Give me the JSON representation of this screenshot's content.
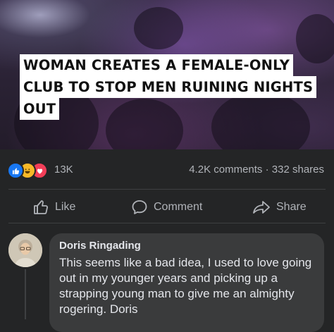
{
  "post": {
    "headline_lines": [
      "WOMAN CREATES A FEMALE-ONLY",
      "CLUB TO STOP MEN RUINING NIGHTS",
      "OUT"
    ]
  },
  "reactions": {
    "icons": [
      "like-icon",
      "haha-icon",
      "love-icon"
    ],
    "count": "13K",
    "comments": "4.2K comments",
    "separator": "·",
    "shares": "332 shares"
  },
  "actions": {
    "like": "Like",
    "comment": "Comment",
    "share": "Share"
  },
  "comment": {
    "author": "Doris Ringading",
    "text": "This seems like a bad idea, I used to love going out in my younger years and picking up a strapping young man to give me an almighty rogering. Doris"
  },
  "colors": {
    "background": "#242526",
    "bubble": "#3a3b3c",
    "text_primary": "#e4e6eb",
    "text_secondary": "#b0b3b8",
    "like_blue": "#1877f2",
    "love_red": "#f33e58",
    "haha_yellow": "#f7b928"
  }
}
